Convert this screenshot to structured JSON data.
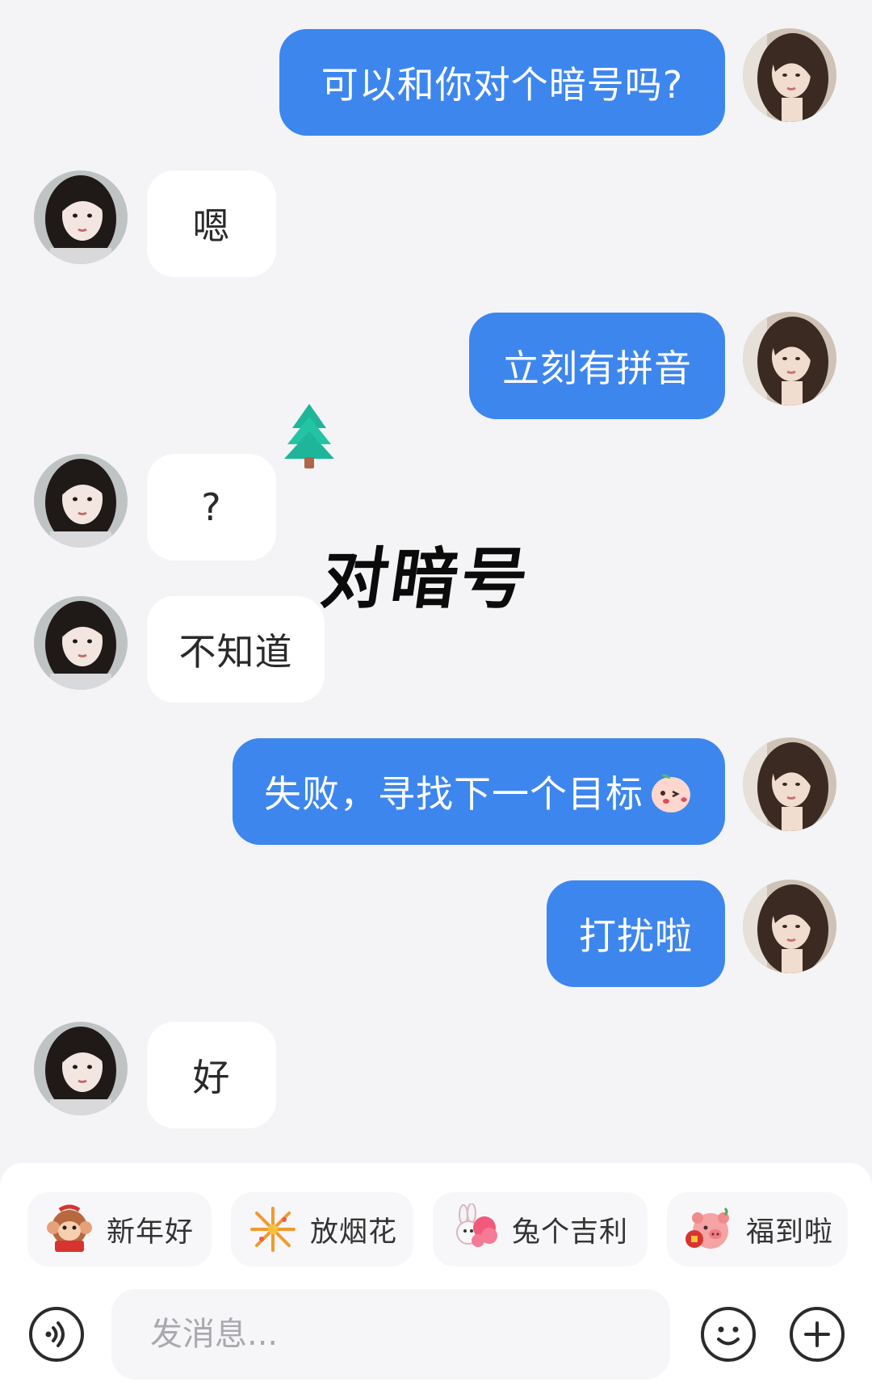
{
  "messages": [
    {
      "side": "me",
      "text": "可以和你对个暗号吗?"
    },
    {
      "side": "them",
      "text": "嗯"
    },
    {
      "side": "me",
      "text": "立刻有拼音"
    },
    {
      "side": "them",
      "text": "?"
    },
    {
      "side": "them",
      "text": "不知道"
    },
    {
      "side": "me",
      "text": "失败，寻找下一个目标"
    },
    {
      "side": "me",
      "text": "打扰啦"
    },
    {
      "side": "them",
      "text": "好"
    }
  ],
  "overlay": {
    "title": "对暗号"
  },
  "quick_replies": [
    {
      "label": "新年好",
      "icon": "monkey-sticker"
    },
    {
      "label": "放烟花",
      "icon": "fireworks-sticker"
    },
    {
      "label": "兔个吉利",
      "icon": "rabbit-sticker"
    },
    {
      "label": "福到啦",
      "icon": "pig-sticker"
    }
  ],
  "composer": {
    "placeholder": "发消息..."
  },
  "colors": {
    "outgoing_bubble": "#3d86ee",
    "incoming_bubble": "#ffffff",
    "background": "#f4f4f6"
  }
}
